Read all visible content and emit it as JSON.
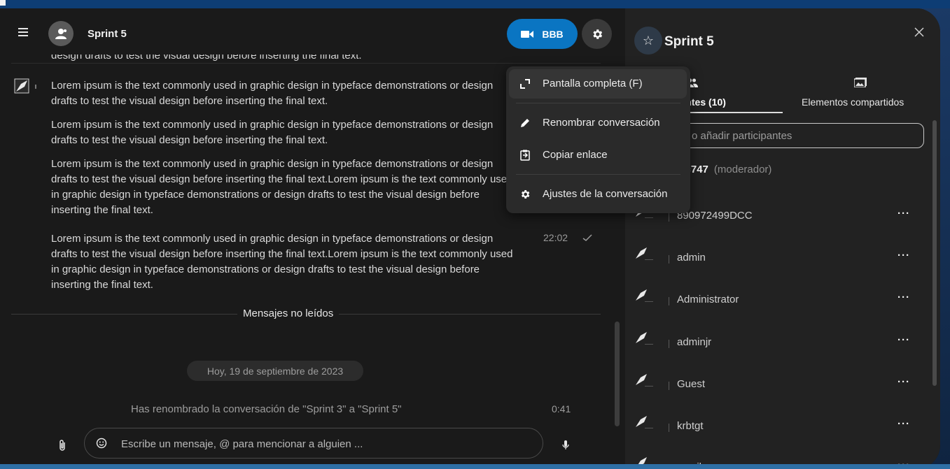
{
  "header": {
    "title": "Sprint 5",
    "call_label": "BBB"
  },
  "messages": {
    "cut_top": "design drafts to test the visual design before inserting the final text.",
    "items": [
      "Lorem ipsum is the text commonly used in graphic design in typeface demonstrations or design drafts to test the visual design before inserting the final text.",
      "Lorem ipsum is the text commonly used in graphic design in typeface demonstrations or design drafts to test the visual design before inserting the final text.",
      "Lorem ipsum is the text commonly used in graphic design in typeface demonstrations or design drafts to test the visual design before inserting the final text.Lorem ipsum is the text commonly used in graphic design in typeface demonstrations or design drafts to test the visual design before inserting the final text.",
      "Lorem ipsum is the text commonly used in graphic design in typeface demonstrations or design drafts to test the visual design before inserting the final text.Lorem ipsum is the text commonly used in graphic design in typeface demonstrations or design drafts to test the visual design before inserting the final text."
    ],
    "last_time": "22:02",
    "unread_label": "Mensajes no leídos",
    "date_chip": "Hoy, 19 de septiembre de 2023",
    "system_message": "Has renombrado la conversación de \"Sprint 3\" a \"Sprint 5\"",
    "system_time": "0:41"
  },
  "composer": {
    "placeholder": "Escribe un mensaje, @ para mencionar a alguien ..."
  },
  "dropdown": {
    "items": [
      {
        "label": "Pantalla completa (F)",
        "icon": "fullscreen-icon"
      },
      {
        "label": "Renombrar conversación",
        "icon": "pencil-icon"
      },
      {
        "label": "Copiar enlace",
        "icon": "clipboard-icon"
      },
      {
        "label": "Ajustes de la conversación",
        "icon": "gear-icon"
      }
    ]
  },
  "sidebar": {
    "title": "Sprint 5",
    "tab_participants": "pantes (10)",
    "tab_shared": "Elementos compartidos",
    "search_placeholder": "o añadir participantes",
    "moderator_name": "elc747",
    "moderator_role": "(moderador)",
    "participants": [
      {
        "name": "890972499DCC",
        "more": "···"
      },
      {
        "name": "admin",
        "more": "···"
      },
      {
        "name": "Administrator",
        "more": "···"
      },
      {
        "name": "adminjr",
        "more": "···"
      },
      {
        "name": "Guest",
        "more": "···"
      },
      {
        "name": "krbtgt",
        "more": "···"
      },
      {
        "name": "ymail",
        "more": "···"
      }
    ]
  },
  "colors": {
    "accent": "#0a75c2",
    "background": "#1a1a1a",
    "sidebar": "#222222"
  }
}
